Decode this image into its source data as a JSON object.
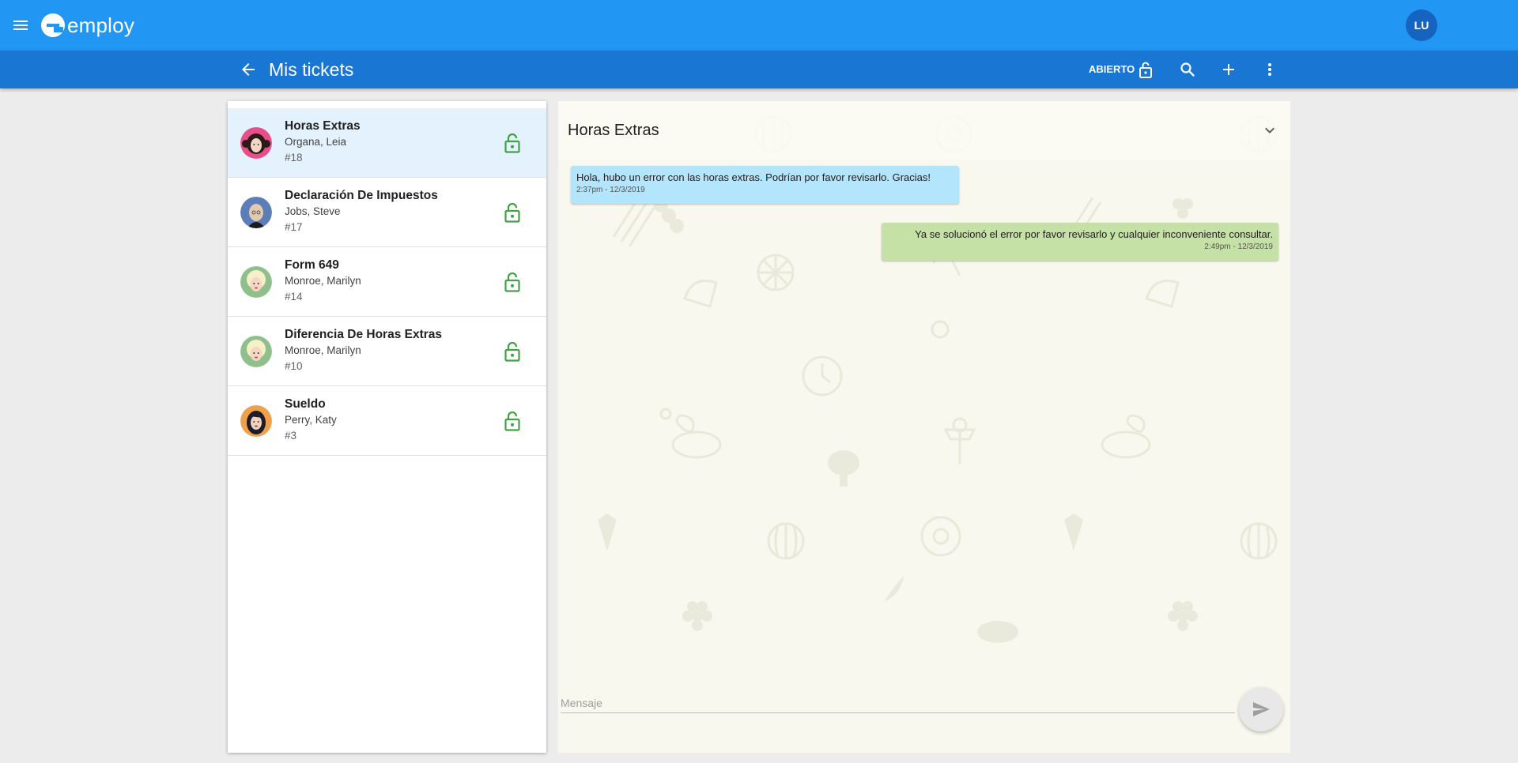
{
  "app": {
    "brand": "employ",
    "user_initials": "LU",
    "colors": {
      "primary": "#2196f3",
      "primary_dark": "#1976d2",
      "lock_green": "#43a047",
      "incoming_bubble": "#b3e5fc",
      "outgoing_bubble": "#c5e1a5"
    }
  },
  "toolbar": {
    "title": "Mis tickets",
    "filter_label": "ABIERTO",
    "icons": [
      "arrow-back-icon",
      "lock-open-icon",
      "search-icon",
      "add-icon",
      "more-vert-icon"
    ]
  },
  "tickets": [
    {
      "title": "Horas Extras",
      "person": "Organa, Leia",
      "number": "#18",
      "status_icon": "lock-open-icon",
      "selected": true
    },
    {
      "title": "Declaración De Impuestos",
      "person": "Jobs, Steve",
      "number": "#17",
      "status_icon": "lock-open-icon",
      "selected": false
    },
    {
      "title": "Form 649",
      "person": "Monroe, Marilyn",
      "number": "#14",
      "status_icon": "lock-open-icon",
      "selected": false
    },
    {
      "title": "Diferencia De Horas Extras",
      "person": "Monroe, Marilyn",
      "number": "#10",
      "status_icon": "lock-open-icon",
      "selected": false
    },
    {
      "title": "Sueldo",
      "person": "Perry, Katy",
      "number": "#3",
      "status_icon": "lock-open-icon",
      "selected": false
    }
  ],
  "chat": {
    "title": "Horas Extras",
    "messages": [
      {
        "direction": "incoming",
        "text": "Hola, hubo un error con las horas extras. Podrían por favor revisarlo. Gracias!",
        "time": "2:37pm - 12/3/2019"
      },
      {
        "direction": "outgoing",
        "text": "Ya se solucionó el error por favor revisarlo y cualquier inconveniente consultar.",
        "time": "2:49pm - 12/3/2019"
      }
    ],
    "input_placeholder": "Mensaje",
    "input_value": ""
  }
}
